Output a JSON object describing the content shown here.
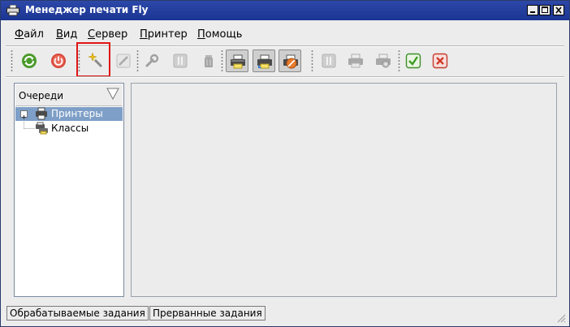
{
  "window": {
    "title": "Менеджер печати Fly",
    "icon": "printer-icon",
    "controls": [
      "minimize-icon",
      "maximize-icon",
      "close-icon"
    ]
  },
  "menu": [
    {
      "label": "Файл",
      "underline": "Ф",
      "rest": "айл"
    },
    {
      "label": "Вид",
      "underline": "В",
      "rest": "ид"
    },
    {
      "label": "Сервер",
      "underline": "С",
      "rest": "ервер"
    },
    {
      "label": "Принтер",
      "underline": "П",
      "rest": "ринтер"
    },
    {
      "label": "Помощь",
      "underline": "П",
      "rest": "омощь"
    }
  ],
  "toolbar": [
    {
      "name": "refresh-button",
      "icon": "refresh-icon"
    },
    {
      "name": "stop-server-button",
      "icon": "power-icon"
    },
    {
      "name": "add-printer-wizard-button",
      "icon": "magic-wand-icon",
      "highlighted": true
    },
    {
      "name": "edit-button",
      "icon": "pencil-icon",
      "disabled": true
    },
    {
      "name": "settings-button",
      "icon": "wrench-icon",
      "disabled": true
    },
    {
      "name": "pause-button",
      "icon": "pause-icon",
      "disabled": true
    },
    {
      "name": "delete-button",
      "icon": "trash-icon",
      "disabled": true
    },
    {
      "name": "printer-button",
      "icon": "printer-icon",
      "pressed": true
    },
    {
      "name": "printer-share-button",
      "icon": "printer-share-icon",
      "pressed": true
    },
    {
      "name": "printer-reject-button",
      "icon": "printer-reject-icon",
      "pressed": true
    },
    {
      "name": "pause-job-button",
      "icon": "pause-icon",
      "disabled": true
    },
    {
      "name": "print-job-button",
      "icon": "print-job-icon",
      "disabled": true
    },
    {
      "name": "job-settings-button",
      "icon": "printer-settings-icon",
      "disabled": true
    },
    {
      "name": "accept-button",
      "icon": "check-icon"
    },
    {
      "name": "reject-button",
      "icon": "x-icon"
    }
  ],
  "sidebar": {
    "header": "Очереди",
    "filter_icon": "filter-icon",
    "items": [
      {
        "label": "Принтеры",
        "icon": "printer-icon",
        "selected": true,
        "expandable": true
      },
      {
        "label": "Классы",
        "icon": "printer-class-icon",
        "selected": false,
        "expandable": false
      }
    ]
  },
  "bottom_tabs": [
    "Обрабатываемые задания",
    "Прерванные задания"
  ],
  "colors": {
    "titlebar": "#1f3a9a",
    "selection": "#7e9fc7",
    "highlight_box": "#e01515"
  }
}
